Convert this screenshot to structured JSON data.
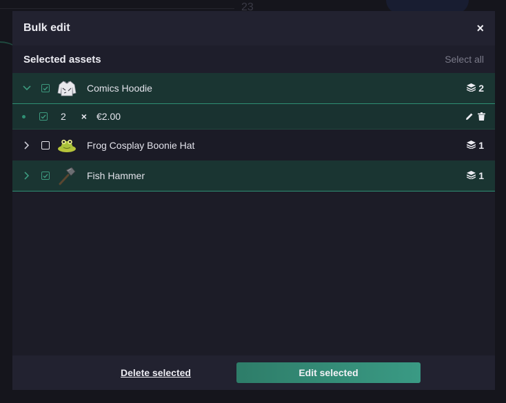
{
  "background": {
    "number": "23"
  },
  "modal": {
    "title": "Bulk edit",
    "close_label": "×",
    "section_title": "Selected assets",
    "select_all_label": "Select all"
  },
  "assets": [
    {
      "name": "Comics Hoodie",
      "count": "2",
      "expanded": true,
      "checked": true,
      "icon": "hoodie-icon"
    },
    {
      "name": "Frog Cosplay Boonie Hat",
      "count": "1",
      "expanded": false,
      "checked": false,
      "icon": "frog-hat-icon"
    },
    {
      "name": "Fish Hammer",
      "count": "1",
      "expanded": false,
      "checked": true,
      "icon": "hammer-icon"
    }
  ],
  "listing": {
    "quantity": "2",
    "multiplier": "×",
    "price": "€2.00"
  },
  "footer": {
    "delete_label": "Delete selected",
    "edit_label": "Edit selected"
  },
  "colors": {
    "accent": "#2f8f74",
    "selected_row": "#1a3532",
    "modal_bg": "#1c1c27"
  }
}
